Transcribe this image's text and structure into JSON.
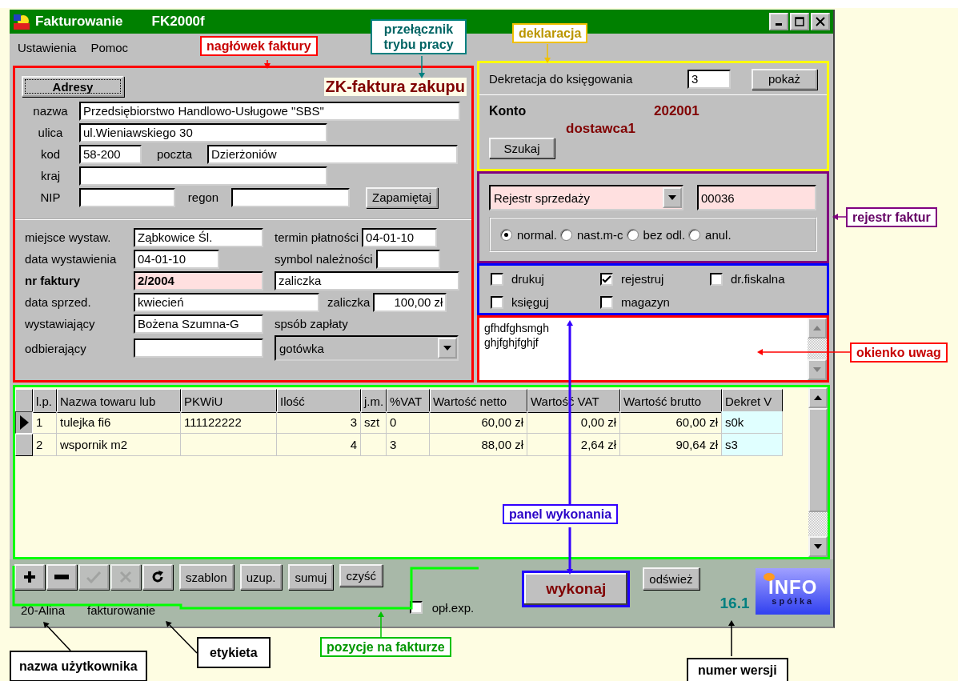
{
  "window": {
    "title": "Fakturowanie",
    "subtitle": "FK2000f"
  },
  "menu": [
    "Ustawienia",
    "Pomoc"
  ],
  "header": {
    "addresses_button": "Adresy",
    "mode": "ZK-faktura zakupu",
    "name": {
      "label": "nazwa",
      "value": "Przedsiębiorstwo Handlowo-Usługowe \"SBS\""
    },
    "street": {
      "label": "ulica",
      "value": "ul.Wieniawskiego 30"
    },
    "postal_code": {
      "label": "kod",
      "value": "58-200"
    },
    "post_office": {
      "label": "poczta",
      "value": "Dzierżoniów"
    },
    "country": {
      "label": "kraj"
    },
    "nip": {
      "label": "NIP"
    },
    "regon": {
      "label": "regon"
    },
    "save_button": "Zapamiętaj"
  },
  "invoice": {
    "place": {
      "label": "miejsce wystaw.",
      "value": "Ząbkowice Śl."
    },
    "issue_date": {
      "label": "data wystawienia",
      "value": "04-01-10"
    },
    "number": {
      "label": "nr faktury",
      "value": "2/2004"
    },
    "sale_date": {
      "label": "data sprzed.",
      "value": "kwiecień"
    },
    "issuer": {
      "label": "wystawiający",
      "value": "Bożena Szumna-G"
    },
    "receiver": {
      "label": "odbierający"
    },
    "due_date": {
      "label": "termin płatności",
      "value": "04-01-10"
    },
    "receivable_symbol": {
      "label": "symbol należności"
    },
    "note": {
      "value": "zaliczka"
    },
    "advance": {
      "label": "zaliczka",
      "value": "100,00 zł"
    },
    "payment": {
      "label": "spsób zapłaty",
      "value": "gotówka"
    }
  },
  "declaration": {
    "label": "Dekretacja do księgowania",
    "value": "3",
    "show_button": "pokaż",
    "account_label": "Konto",
    "account": "202001",
    "supplier": "dostawca1",
    "search_button": "Szukaj"
  },
  "register": {
    "value": "Rejestr sprzedaży",
    "number": "00036",
    "options": [
      {
        "label": "normal.",
        "selected": true
      },
      {
        "label": "nast.m-c",
        "selected": false
      },
      {
        "label": "bez odl.",
        "selected": false
      },
      {
        "label": "anul.",
        "selected": false
      }
    ]
  },
  "options": [
    {
      "label": "drukuj",
      "checked": false
    },
    {
      "label": "rejestruj",
      "checked": true
    },
    {
      "label": "dr.fiskalna",
      "checked": false
    },
    {
      "label": "księguj",
      "checked": false
    },
    {
      "label": "magazyn",
      "checked": false
    }
  ],
  "notes": [
    "gfhdfghsmgh",
    "ghjfghjfghjf"
  ],
  "table": {
    "columns": [
      "l.p.",
      "Nazwa towaru lub",
      "PKWiU",
      "Ilość",
      "j.m.",
      "%VAT",
      "Wartość netto",
      "Wartość VAT",
      "Wartość brutto",
      "Dekret V"
    ],
    "rows": [
      {
        "selected": true,
        "cells": [
          "1",
          "tulejka fi6",
          "111122222",
          "3",
          "szt",
          "0",
          "60,00 zł",
          "0,00 zł",
          "60,00 zł",
          "s0k"
        ]
      },
      {
        "selected": false,
        "cells": [
          "2",
          "wspornik m2",
          "",
          "4",
          "",
          "3",
          "88,00 zł",
          "2,64 zł",
          "90,64 zł",
          "s3"
        ]
      }
    ]
  },
  "tool_buttons": [
    {
      "kind": "add",
      "disabled": false
    },
    {
      "kind": "remove",
      "disabled": false
    },
    {
      "kind": "confirm",
      "disabled": true
    },
    {
      "kind": "cancel",
      "disabled": true
    },
    {
      "kind": "refresh",
      "disabled": false
    }
  ],
  "buttons": [
    "szablon",
    "uzup.",
    "sumuj",
    "czyść"
  ],
  "export_fee": {
    "label": "opł.exp.",
    "checked": false
  },
  "execute_button": "wykonaj",
  "refresh_button": "odśwież",
  "version": "16.1",
  "logo": {
    "name": "INFO",
    "sub": "spółka"
  },
  "status": [
    "20-Alina",
    "fakturowanie"
  ],
  "annotations": [
    {
      "text": "nagłówek faktury",
      "color": "#ff0000"
    },
    {
      "text": "przełącznik trybu pracy",
      "color": "#008080"
    },
    {
      "text": "deklaracja",
      "color": "#f0c000"
    },
    {
      "text": "rejestr faktur",
      "color": "#800080"
    },
    {
      "text": "okienko uwag",
      "color": "#ff0000"
    },
    {
      "text": "panel wykonania",
      "color": "#3300ff"
    },
    {
      "text": "pozycje na fakturze",
      "color": "#00c000"
    },
    {
      "text": "nazwa użytkownika",
      "color": "#000000"
    },
    {
      "text": "etykieta",
      "color": "#000000"
    },
    {
      "text": "numer wersji",
      "color": "#000000"
    }
  ]
}
